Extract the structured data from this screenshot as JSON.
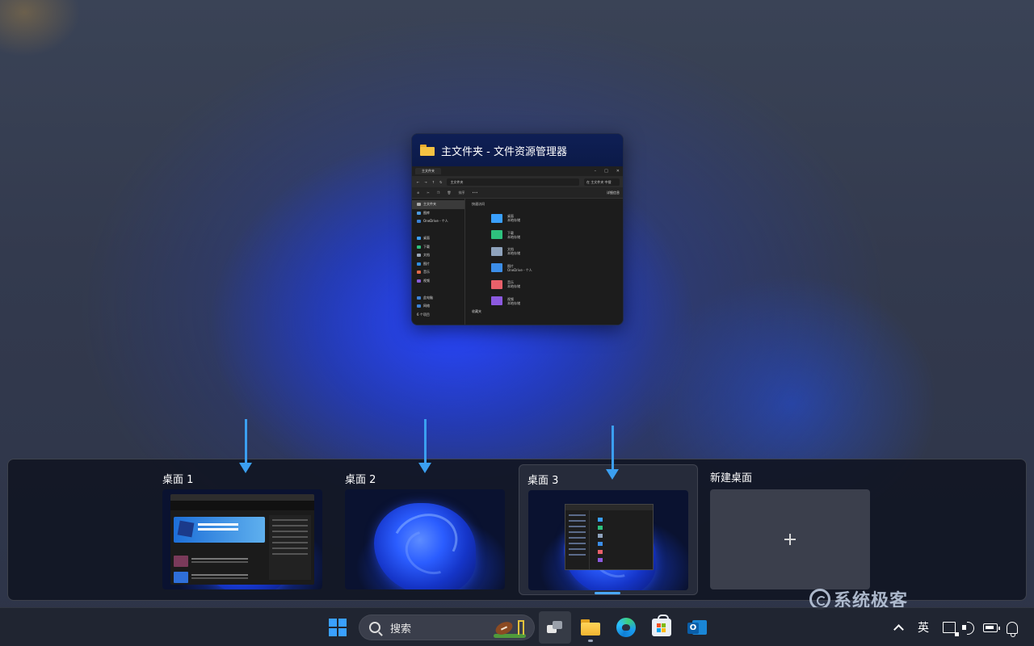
{
  "window_preview": {
    "title": "主文件夹 - 文件资源管理器",
    "explorer": {
      "tab": "主文件夹",
      "address": "主文件夹",
      "search_placeholder": "在 主文件夹 中搜",
      "details_label": "详细信息",
      "sort_label": "排序",
      "nav_items": [
        "主文件夹",
        "图库",
        "OneDrive - 个人",
        "桌面",
        "下载",
        "文档",
        "图片",
        "音乐",
        "视频",
        "此电脑",
        "网络"
      ],
      "section_quick": "快速访问",
      "section_recent": "收藏夹",
      "folders": [
        {
          "name": "桌面",
          "sub": "本地存储"
        },
        {
          "name": "下载",
          "sub": "本地存储"
        },
        {
          "name": "文档",
          "sub": "本地存储"
        },
        {
          "name": "图片",
          "sub": "OneDrive - 个人"
        },
        {
          "name": "音乐",
          "sub": "本地存储"
        },
        {
          "name": "视频",
          "sub": "本地存储"
        }
      ],
      "status": "6 个项目"
    }
  },
  "desktops": [
    {
      "label": "桌面 1"
    },
    {
      "label": "桌面 2"
    },
    {
      "label": "桌面 3"
    },
    {
      "label": "新建桌面"
    }
  ],
  "watermark": "系统极客",
  "taskbar": {
    "search_label": "搜索",
    "ime_label": "英"
  },
  "colors": {
    "accent": "#3b9ff0",
    "taskbar": "#202430",
    "strip": "#121624"
  }
}
